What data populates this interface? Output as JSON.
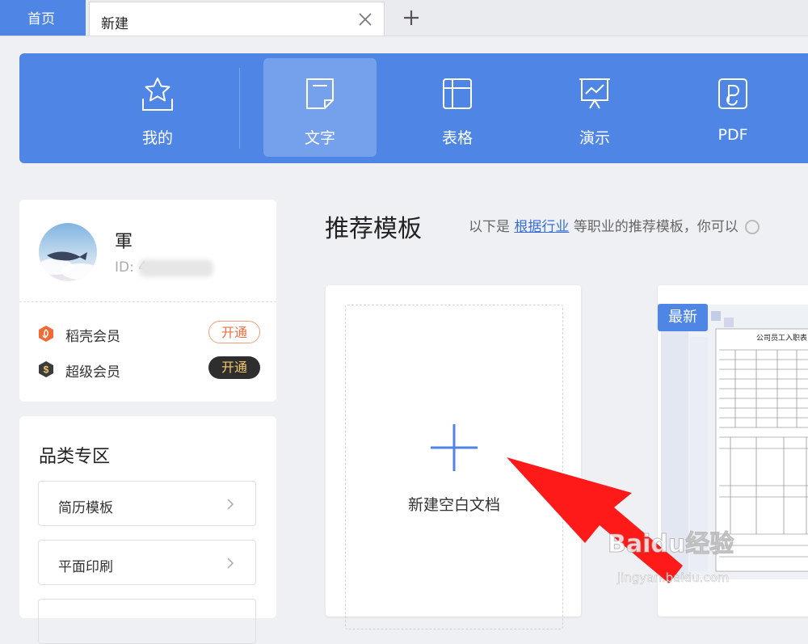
{
  "tabs": {
    "home": "首页",
    "current": "新建"
  },
  "categories": [
    {
      "label": "我的",
      "icon": "star-box-icon"
    },
    {
      "label": "文字",
      "icon": "document-icon",
      "active": true
    },
    {
      "label": "表格",
      "icon": "table-icon"
    },
    {
      "label": "演示",
      "icon": "presentation-icon"
    },
    {
      "label": "PDF",
      "icon": "pdf-icon"
    }
  ],
  "user": {
    "name": "軍",
    "id_prefix": "ID: 4",
    "memberships": [
      {
        "label": "稻壳会员",
        "button": "开通",
        "color": "#f06a35"
      },
      {
        "label": "超级会员",
        "button": "开通",
        "color": "#3b3b3b"
      }
    ]
  },
  "zone": {
    "title": "品类专区",
    "items": [
      "简历模板",
      "平面印刷"
    ]
  },
  "recommend": {
    "title": "推荐模板",
    "subtitle_pre": "以下是",
    "subtitle_link": "根据行业",
    "subtitle_post": "等职业的推荐模板，你可以"
  },
  "blank": {
    "label": "新建空白文档"
  },
  "template": {
    "badge": "最新",
    "doc_title": "公司员工入职表"
  },
  "watermark": {
    "main": "Baidu经验",
    "sub": "jingyan.baidu.com"
  },
  "colors": {
    "accent": "#4f86e6",
    "active_tab": "#74a0ec",
    "arrow": "#ff1a1a"
  }
}
